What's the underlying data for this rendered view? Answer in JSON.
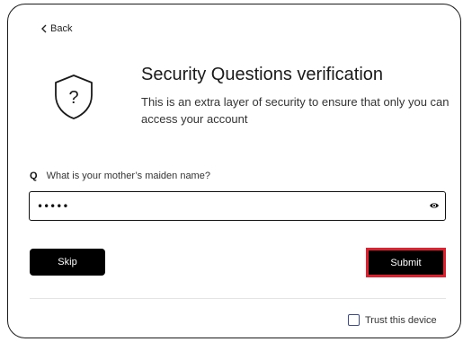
{
  "nav": {
    "back_label": "Back"
  },
  "header": {
    "title": "Security Questions verification",
    "subtitle": "This is an extra layer of security to ensure that only you can access your account"
  },
  "question": {
    "marker": "Q",
    "text": "What is your mother’s maiden name?"
  },
  "answer": {
    "value": "•••••"
  },
  "actions": {
    "skip_label": "Skip",
    "submit_label": "Submit"
  },
  "trust": {
    "label": "Trust this device",
    "checked": false
  },
  "colors": {
    "button_bg": "#000000",
    "button_text": "#ffffff",
    "highlight_border": "#e0202f",
    "checkbox_border": "#3b4a8a"
  },
  "icons": {
    "back": "chevron-left-icon",
    "header": "shield-question-icon",
    "reveal": "eye-icon"
  }
}
